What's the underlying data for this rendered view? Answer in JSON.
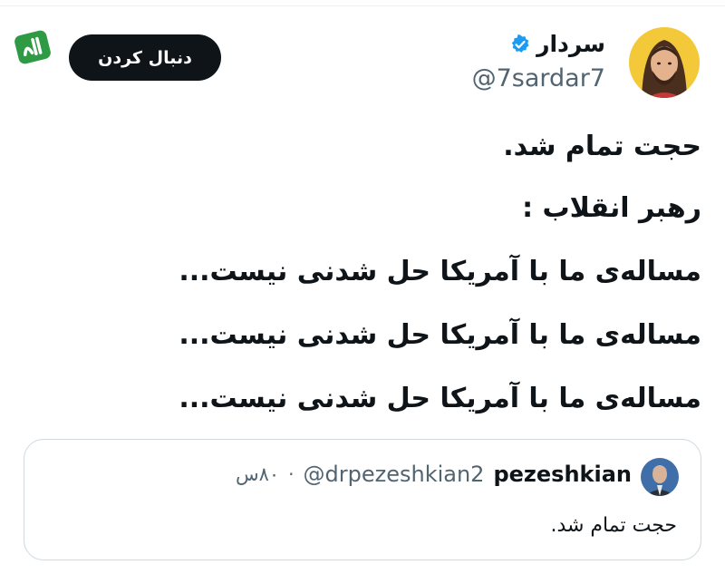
{
  "header": {
    "display_name": "سردار",
    "handle": "@7sardar7",
    "follow_label": "دنبال کردن",
    "verified_icon": "verified-badge-icon"
  },
  "brand": {
    "logo_icon": "brand-logo-icon",
    "color": "#2e9a44"
  },
  "tweet": {
    "lines": [
      "حجت تمام شد.",
      "رهبر انقلاب :",
      "مساله‌ی ما با آمریکا حل شدنی نیست...",
      "مساله‌ی ما با آمریکا حل شدنی نیست...",
      "مساله‌ی ما با آمریکا حل شدنی نیست..."
    ]
  },
  "quote": {
    "name": "pezeshkian",
    "handle": "@drpezeshkian2",
    "separator": "·",
    "time": "۸۰س",
    "text": "حجت تمام شد."
  },
  "colors": {
    "text": "#0f1419",
    "muted": "#536471",
    "verified": "#1d9bf0",
    "border": "#cfd9de"
  }
}
